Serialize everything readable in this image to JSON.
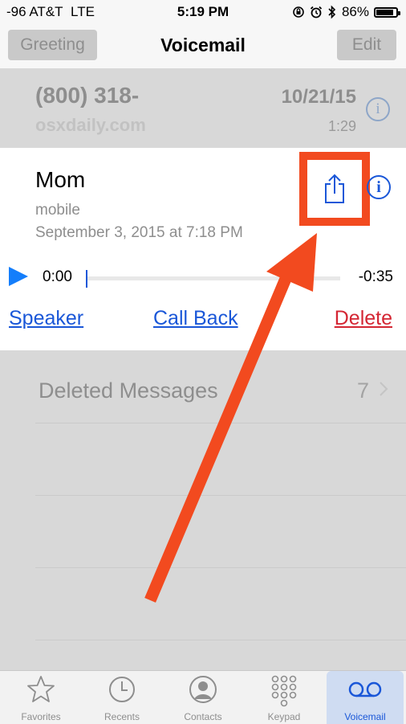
{
  "status_bar": {
    "carrier": "-96 AT&T",
    "network": "LTE",
    "time": "5:19 PM",
    "battery_percent": "86%",
    "battery_level": 0.86
  },
  "nav": {
    "greeting_label": "Greeting",
    "title": "Voicemail",
    "edit_label": "Edit"
  },
  "voicemails": [
    {
      "number": "(800) 318-",
      "subtitle": "osxdaily.com",
      "date": "10/21/15",
      "duration": "1:29"
    }
  ],
  "expanded": {
    "name": "Mom",
    "type": "mobile",
    "date": "September 3, 2015 at 7:18 PM",
    "elapsed": "0:00",
    "remaining": "-0:35",
    "progress": 0
  },
  "actions": {
    "speaker": "Speaker",
    "call_back": "Call Back",
    "delete": "Delete"
  },
  "deleted": {
    "label": "Deleted Messages",
    "count": "7"
  },
  "tabs": [
    {
      "label": "Favorites",
      "icon": "star-icon"
    },
    {
      "label": "Recents",
      "icon": "clock-icon"
    },
    {
      "label": "Contacts",
      "icon": "person-icon"
    },
    {
      "label": "Keypad",
      "icon": "keypad-icon"
    },
    {
      "label": "Voicemail",
      "icon": "voicemail-icon",
      "active": true
    }
  ],
  "colors": {
    "accent": "#1a57d8",
    "delete": "#d42633",
    "highlight": "#f24a1f",
    "play": "#147efb"
  }
}
